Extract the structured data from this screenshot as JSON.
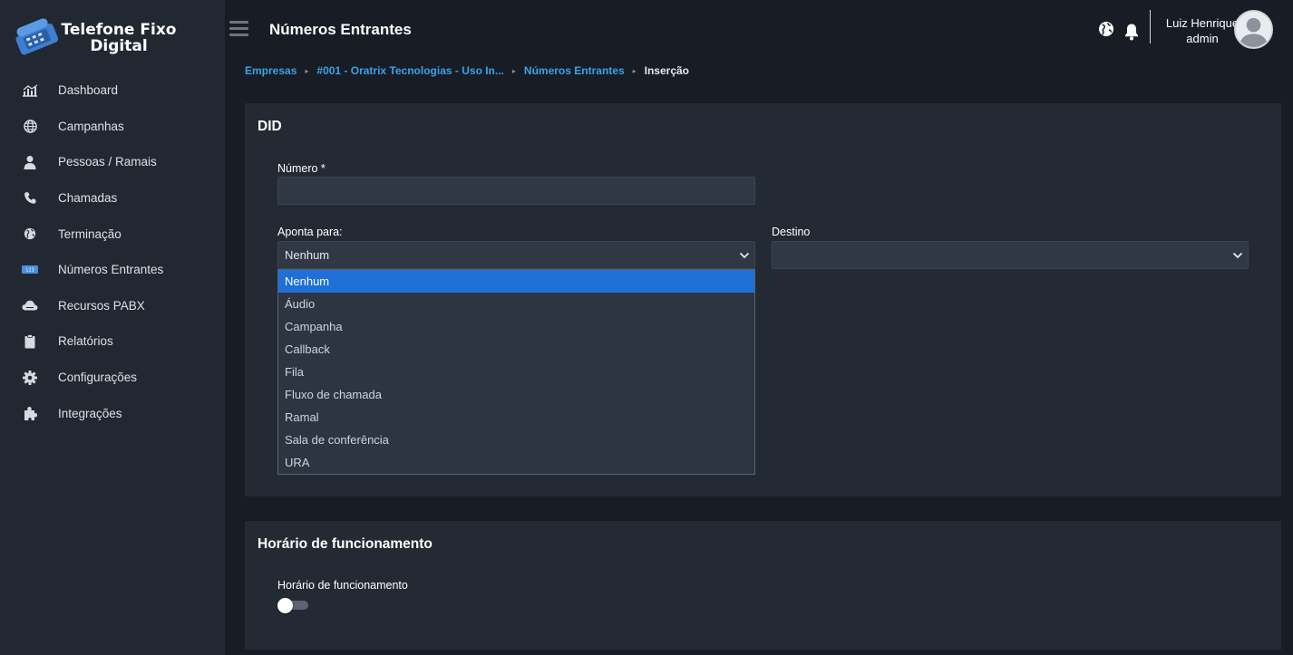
{
  "brand": {
    "line1": "Telefone Fixo",
    "line2": "Digital"
  },
  "sidebar": {
    "items": [
      {
        "label": "Dashboard",
        "icon": "chart-icon"
      },
      {
        "label": "Campanhas",
        "icon": "globe-icon"
      },
      {
        "label": "Pessoas / Ramais",
        "icon": "user-icon"
      },
      {
        "label": "Chamadas",
        "icon": "phone-icon"
      },
      {
        "label": "Terminação",
        "icon": "globe-pin-icon"
      },
      {
        "label": "Números Entrantes",
        "icon": "did-icon"
      },
      {
        "label": "Recursos PABX",
        "icon": "cloud-icon"
      },
      {
        "label": "Relatórios",
        "icon": "clipboard-icon"
      },
      {
        "label": "Configurações",
        "icon": "gear-icon"
      },
      {
        "label": "Integrações",
        "icon": "puzzle-icon"
      }
    ]
  },
  "header": {
    "title": "Números Entrantes",
    "user_name": "Luiz Henrique",
    "user_role": "admin"
  },
  "breadcrumb": {
    "items": [
      "Empresas",
      "#001 - Oratrix Tecnologias - Uso In...",
      "Números Entrantes"
    ],
    "current": "Inserção"
  },
  "did_card": {
    "title": "DID",
    "numero_label": "Número *",
    "numero_value": "",
    "aponta_label": "Aponta para:",
    "aponta_value": "Nenhum",
    "destino_label": "Destino",
    "destino_value": "",
    "options": [
      "Nenhum",
      "Áudio",
      "Campanha",
      "Callback",
      "Fila",
      "Fluxo de chamada",
      "Ramal",
      "Sala de conferência",
      "URA"
    ],
    "selected_option": "Nenhum"
  },
  "hours_card": {
    "title": "Horário de funcionamento",
    "toggle_label": "Horário de funcionamento",
    "toggle_on": false
  },
  "colors": {
    "accent": "#1f6fd6",
    "link": "#3aa1e8",
    "sidebar_bg": "#222832",
    "page_bg": "#181d25",
    "card_bg": "#242a34"
  }
}
